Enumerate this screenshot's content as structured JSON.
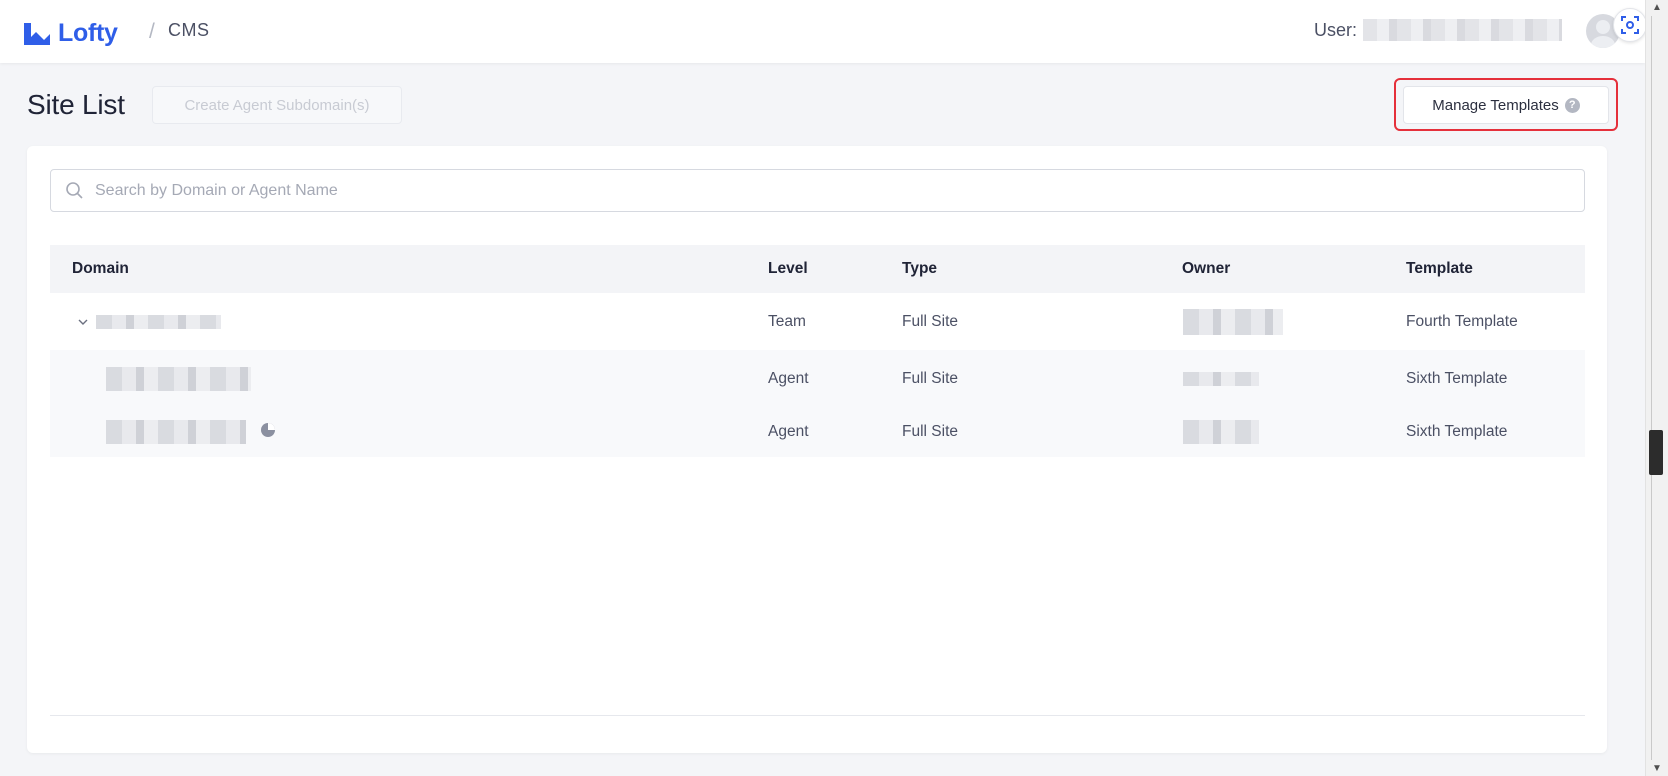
{
  "app": {
    "logo_text": "Lofty",
    "breadcrumb_separator": "/",
    "breadcrumb": "CMS",
    "user_label": "User:",
    "brand_color": "#2f5ee8"
  },
  "page": {
    "title": "Site List",
    "create_button": "Create Agent Subdomain(s)",
    "manage_button": "Manage Templates",
    "help_glyph": "?"
  },
  "search": {
    "placeholder": "Search by Domain or Agent Name"
  },
  "table": {
    "headers": {
      "domain": "Domain",
      "level": "Level",
      "type": "Type",
      "owner": "Owner",
      "template": "Template"
    },
    "rows": [
      {
        "level": "Team",
        "type": "Full Site",
        "template": "Fourth Template",
        "expanded": true,
        "indent": 0
      },
      {
        "level": "Agent",
        "type": "Full Site",
        "template": "Sixth Template",
        "indent": 1
      },
      {
        "level": "Agent",
        "type": "Full Site",
        "template": "Sixth Template",
        "indent": 1,
        "status_icon": "half-circle-icon"
      }
    ]
  }
}
